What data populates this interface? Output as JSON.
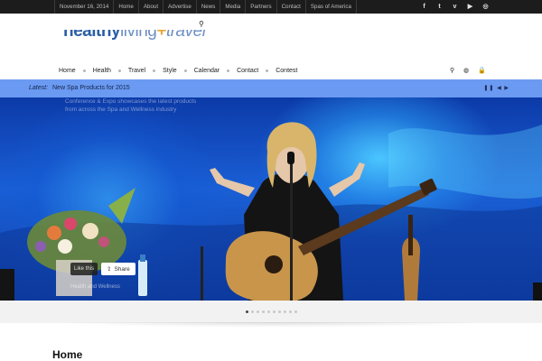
{
  "topbar": {
    "links": [
      "November 16, 2014",
      "Home",
      "About",
      "Advertise",
      "News",
      "Media",
      "Partners",
      "Contact",
      "Spas of America"
    ],
    "social_icons": [
      "facebook-icon",
      "twitter-icon",
      "vimeo-icon",
      "youtube-icon",
      "dribbble-icon"
    ],
    "social_glyphs": [
      "f",
      "t",
      "v",
      "▶",
      "◎"
    ]
  },
  "header": {
    "logo": {
      "part1": "healthy",
      "part2": "living",
      "part3": "+",
      "part4": "travel"
    },
    "search_glyph": "⚲"
  },
  "nav": {
    "items": [
      "Home",
      "Health",
      "Travel",
      "Style",
      "Calendar",
      "Contact",
      "Contest"
    ],
    "tools": [
      {
        "name": "search-icon",
        "glyph": "⚲"
      },
      {
        "name": "globe-icon",
        "glyph": "◍"
      },
      {
        "name": "lock-icon",
        "glyph": "🔒"
      }
    ]
  },
  "latest": {
    "label": "Latest:",
    "headline": "New Spa Products for 2015",
    "controls": "❚❚ ◀ ▶"
  },
  "hero": {
    "ghost_text": "Conference & Expo showcases the latest products from across the Spa and Wellness industry",
    "like_label": "Like this",
    "share_label": "Share",
    "caption": "Health and Wellness"
  },
  "pager": {
    "count": 10,
    "active": 0
  },
  "page": {
    "title": "Home"
  },
  "colors": {
    "topbar_bg": "#1c1c1c",
    "latest_bg": "#6b9af2",
    "hero_blue": "#1a5fd6",
    "logo_blue": "#2b5ea7",
    "logo_orange": "#e8a53a"
  }
}
